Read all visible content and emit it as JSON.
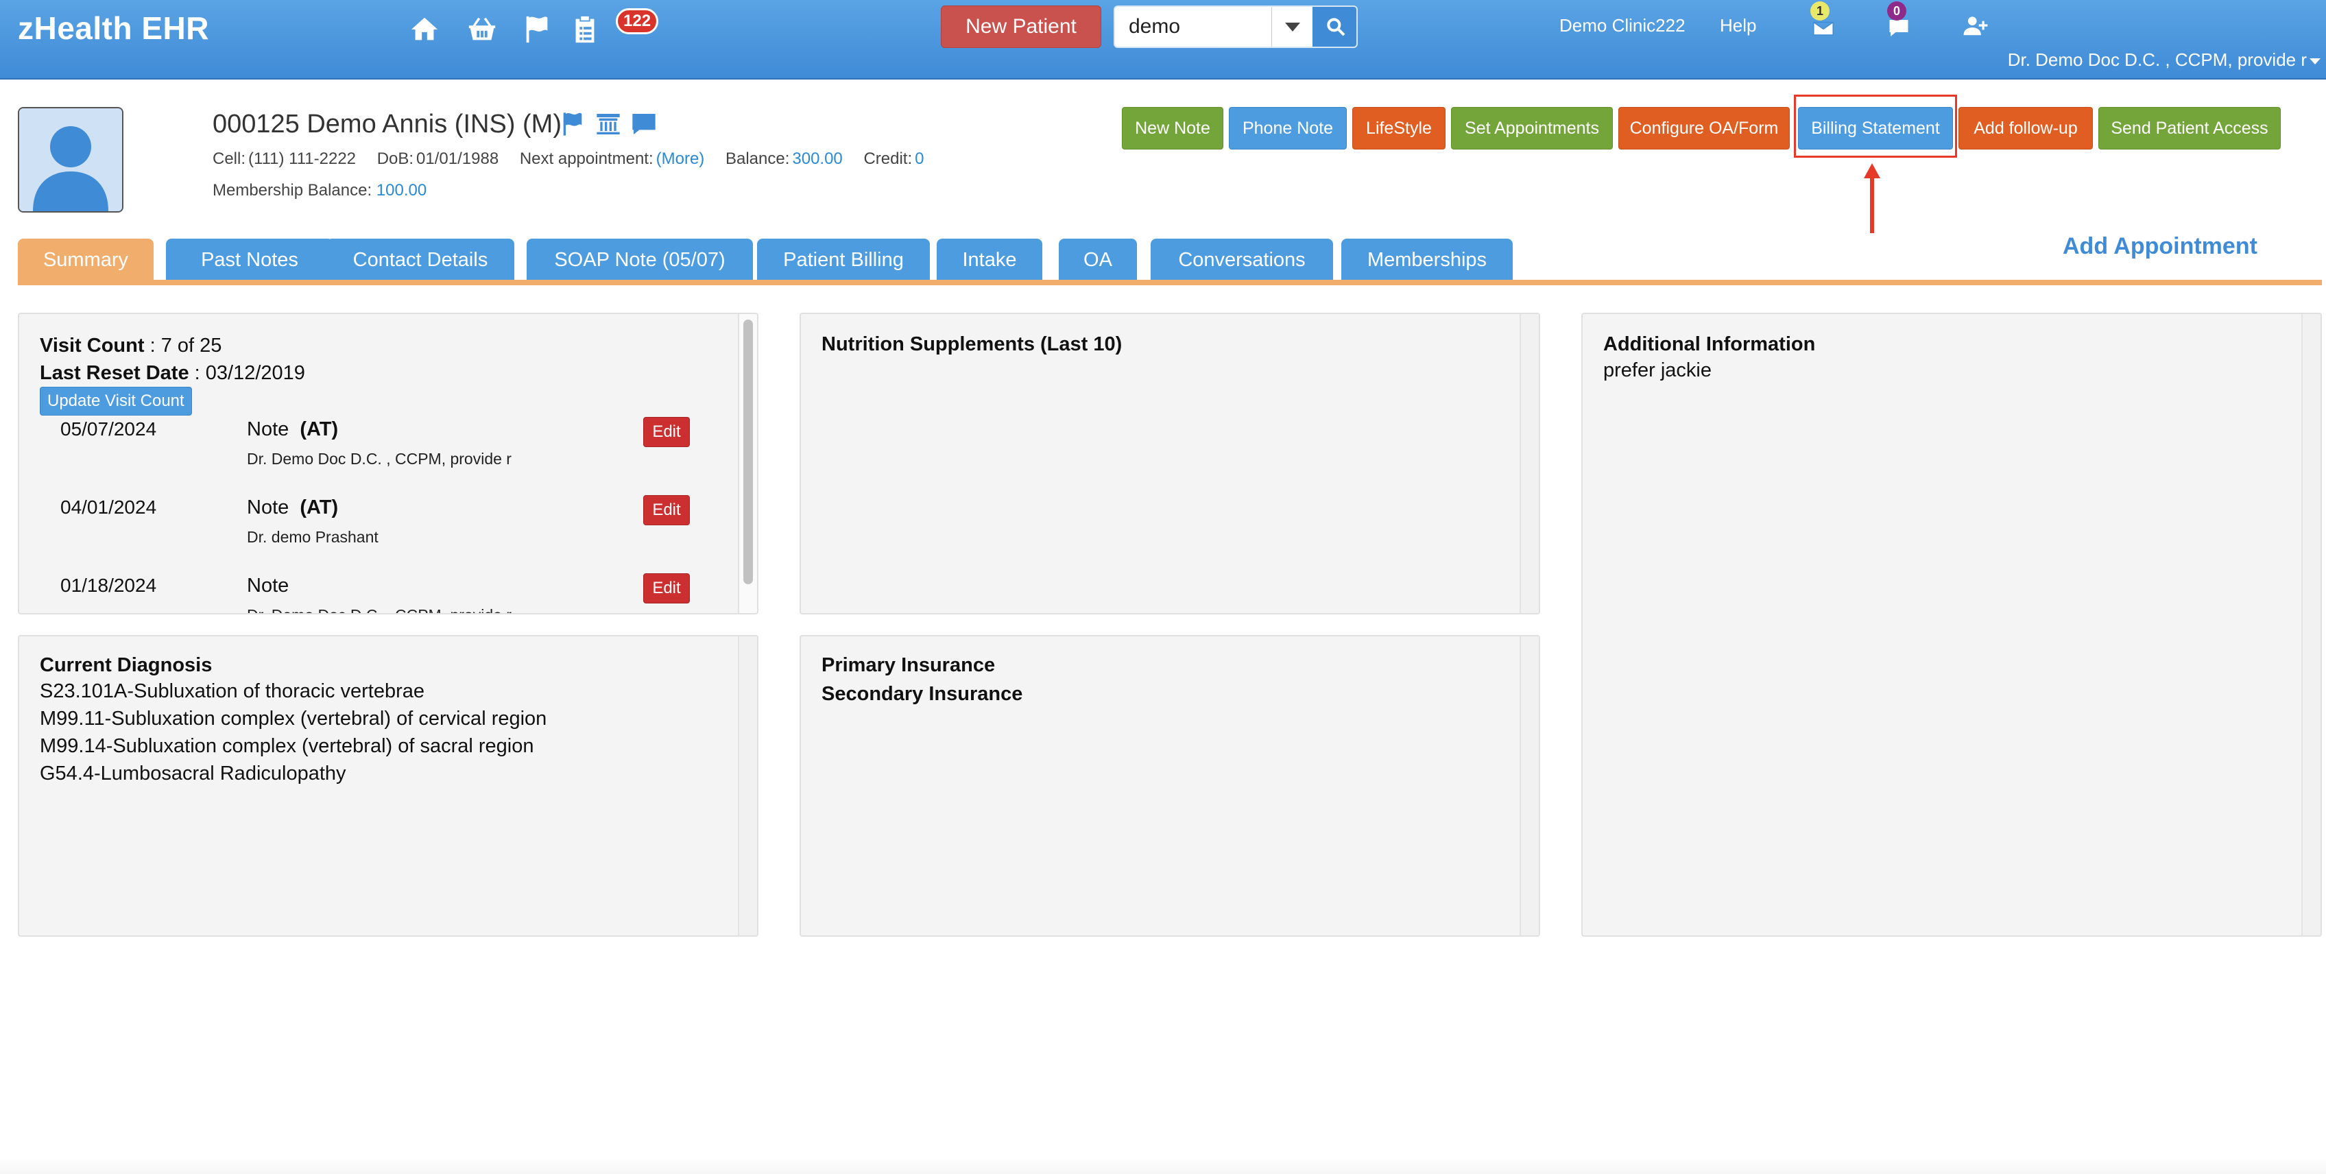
{
  "app": {
    "title": "zHealth EHR"
  },
  "topnav": {
    "icons": [
      "home-icon",
      "basket-icon",
      "flag-icon",
      "clipboard-icon"
    ],
    "task_badge": "122",
    "new_patient_label": "New Patient",
    "search": {
      "value": "demo"
    },
    "clinic_name": "Demo Clinic222",
    "help_label": "Help",
    "mail_badge": "1",
    "chat_badge": "0",
    "user_name": "Dr. Demo Doc D.C. , CCPM, provide r"
  },
  "patient": {
    "title": "000125 Demo Annis  (INS) (M)",
    "cell_label": "Cell:",
    "cell": "(111) 111-2222",
    "dob_label": "DoB:",
    "dob": "01/01/1988",
    "next_appt_label": "Next appointment:",
    "next_appt_link": "(More)",
    "balance_label": "Balance:",
    "balance": "300.00",
    "credit_label": "Credit:",
    "credit": "0",
    "membership_label": "Membership Balance:",
    "membership_balance": "100.00"
  },
  "actions": [
    {
      "label": "New Note",
      "color": "#74a53a"
    },
    {
      "label": "Phone Note",
      "color": "#4d9ce0"
    },
    {
      "label": "LifeStyle",
      "color": "#e05e22"
    },
    {
      "label": "Set Appointments",
      "color": "#74a53a"
    },
    {
      "label": "Configure OA/Form",
      "color": "#e05e22"
    },
    {
      "label": "Billing Statement",
      "color": "#4d9ce0"
    },
    {
      "label": "Add follow-up",
      "color": "#e05e22"
    },
    {
      "label": "Send Patient Access",
      "color": "#74a53a"
    }
  ],
  "add_appointment_label": "Add Appointment",
  "tabs": [
    {
      "label": "Summary",
      "active": true
    },
    {
      "label": "Past Notes"
    },
    {
      "label": "Contact Details"
    },
    {
      "label": "SOAP Note (05/07)"
    },
    {
      "label": "Patient Billing"
    },
    {
      "label": "Intake"
    },
    {
      "label": "OA"
    },
    {
      "label": "Conversations"
    },
    {
      "label": "Memberships"
    }
  ],
  "visits": {
    "count_label": "Visit Count",
    "count_value": ": 7 of 25",
    "reset_label": "Last Reset Date",
    "reset_value": ": 03/12/2019",
    "update_btn": "Update Visit Count",
    "notes": [
      {
        "date": "05/07/2024",
        "type": "Note",
        "tag": "(AT)",
        "by": "Dr. Demo Doc D.C. , CCPM, provide r",
        "edit": "Edit"
      },
      {
        "date": "04/01/2024",
        "type": "Note",
        "tag": "(AT)",
        "by": "Dr. demo Prashant",
        "edit": "Edit"
      },
      {
        "date": "01/18/2024",
        "type": "Note",
        "tag": "",
        "by": "Dr. Demo Doc D.C. , CCPM, provide r",
        "edit": "Edit"
      }
    ]
  },
  "nutrition": {
    "title": "Nutrition Supplements (Last 10)"
  },
  "additional": {
    "title": "Additional Information",
    "text": "prefer jackie"
  },
  "diagnosis": {
    "title": "Current Diagnosis",
    "items": [
      "S23.101A-Subluxation of thoracic vertebrae",
      "M99.11-Subluxation complex (vertebral) of cervical region",
      "M99.14-Subluxation complex (vertebral) of sacral region",
      "G54.4-Lumbosacral Radiculopathy"
    ]
  },
  "insurance": {
    "primary": "Primary Insurance",
    "secondary": "Secondary Insurance"
  },
  "colors": {
    "topbar": "#4a96dd",
    "highlight": "#e53a2a",
    "tab_active": "#f0ad6c",
    "tab": "#4d9ce0",
    "link": "#2a8ad4"
  }
}
